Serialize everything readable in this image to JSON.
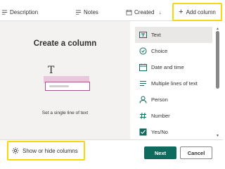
{
  "header": {
    "columns": [
      {
        "label": "Description"
      },
      {
        "label": "Notes"
      },
      {
        "label": "Created",
        "sort_glyph": "↓"
      }
    ],
    "add_column_label": "Add column",
    "add_column_glyph": "+"
  },
  "dialog": {
    "title": "Create a column",
    "illustration_glyph": "T",
    "hint": "Set a single line of text",
    "column_types": [
      {
        "label": "Text",
        "icon": "text-box-icon",
        "selected": true
      },
      {
        "label": "Choice",
        "icon": "choice-icon"
      },
      {
        "label": "Date and time",
        "icon": "calendar-icon"
      },
      {
        "label": "Multiple lines of text",
        "icon": "multiline-text-icon"
      },
      {
        "label": "Person",
        "icon": "person-icon"
      },
      {
        "label": "Number",
        "icon": "number-icon"
      },
      {
        "label": "Yes/No",
        "icon": "yes-no-icon"
      }
    ],
    "show_hide_label": "Show or hide columns",
    "next_label": "Next",
    "cancel_label": "Cancel"
  },
  "colors": {
    "primary": "#0e6b5e",
    "highlight": "#f5d90a",
    "pane_background": "#f3f2f1"
  }
}
